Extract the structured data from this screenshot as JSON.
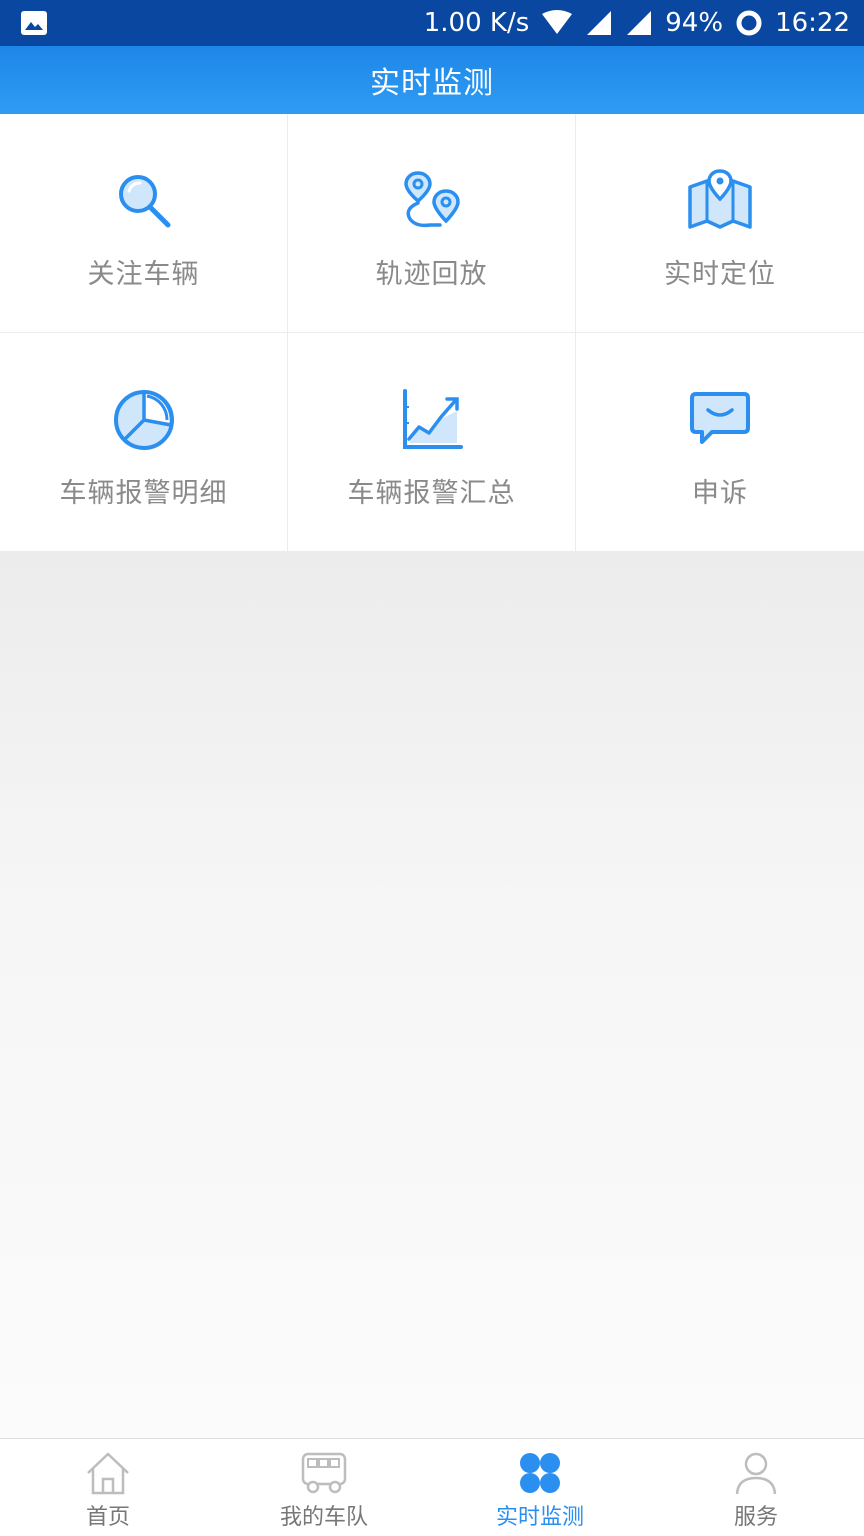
{
  "status_bar": {
    "speed": "1.00 K/s",
    "battery": "94%",
    "time": "16:22",
    "icons": [
      "image-icon",
      "wifi-icon",
      "signal-icon",
      "signal-icon-2",
      "sync-icon"
    ]
  },
  "header": {
    "title": "实时监测"
  },
  "grid": {
    "items": [
      {
        "label": "关注车辆",
        "icon": "search-icon"
      },
      {
        "label": "轨迹回放",
        "icon": "route-icon"
      },
      {
        "label": "实时定位",
        "icon": "map-location-icon"
      },
      {
        "label": "车辆报警明细",
        "icon": "pie-chart-icon"
      },
      {
        "label": "车辆报警汇总",
        "icon": "area-chart-icon"
      },
      {
        "label": "申诉",
        "icon": "message-icon"
      }
    ]
  },
  "tabs": [
    {
      "label": "首页",
      "icon": "home-icon",
      "active": false
    },
    {
      "label": "我的车队",
      "icon": "bus-icon",
      "active": false
    },
    {
      "label": "实时监测",
      "icon": "clover-icon",
      "active": true
    },
    {
      "label": "服务",
      "icon": "person-icon",
      "active": false
    }
  ],
  "colors": {
    "status_bar": "#0a47a0",
    "header": "#2f9cf3",
    "accent": "#2b8ff0",
    "label_gray": "#8a8a8a"
  }
}
